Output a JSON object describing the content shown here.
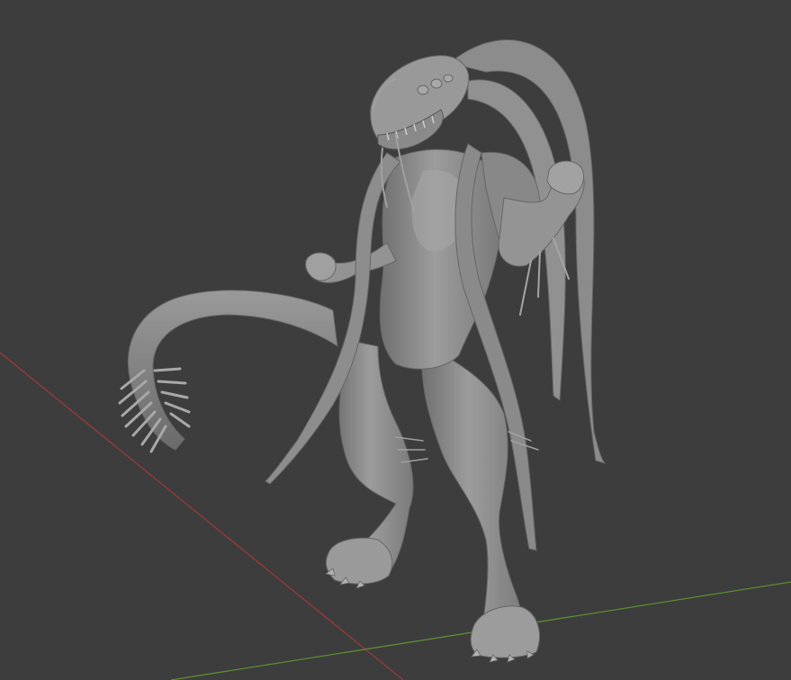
{
  "viewport": {
    "background_color": "#3d3d3d",
    "x_axis_color": "#9a3a3a",
    "y_axis_color": "#5e8c32",
    "model_color": "#8f8f8f",
    "model_shadow_color": "#6e6e6e",
    "model_highlight_color": "#b4b4b4"
  }
}
